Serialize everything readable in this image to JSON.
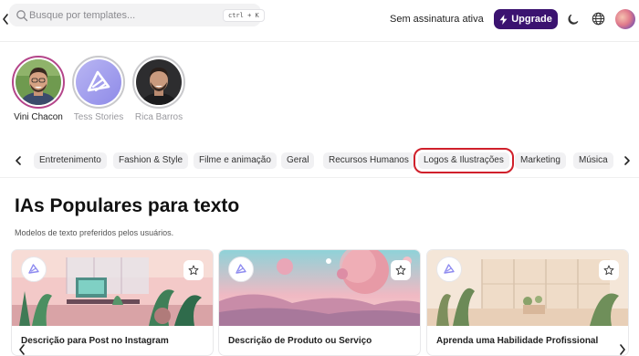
{
  "header": {
    "search": {
      "placeholder": "Busque por templates...",
      "shortcut": "ctrl + K"
    },
    "subscription_status": "Sem assinatura ativa",
    "upgrade_label": "Upgrade"
  },
  "stories": [
    {
      "name": "Vini Chacon",
      "active": true
    },
    {
      "name": "Tess Stories",
      "active": false
    },
    {
      "name": "Rica Barros",
      "active": false
    }
  ],
  "categories": [
    {
      "label": "Entretenimento"
    },
    {
      "label": "Fashion & Style"
    },
    {
      "label": "Filme e animação"
    },
    {
      "label": "Geral"
    },
    {
      "label": "Recursos Humanos"
    },
    {
      "label": "Logos & Ilustrações",
      "highlighted": true
    },
    {
      "label": "Marketing"
    },
    {
      "label": "Música"
    }
  ],
  "section": {
    "title": "IAs Populares para texto",
    "subtitle": "Modelos de texto preferidos pelos usuários."
  },
  "cards": [
    {
      "title": "Descrição para Post no Instagram"
    },
    {
      "title": "Descrição de Produto ou Serviço"
    },
    {
      "title": "Aprenda uma Habilidade Profissional"
    }
  ],
  "colors": {
    "upgrade_bg": "#3b1370",
    "story_active_ring": "#b4458a",
    "highlight_outline": "#d0202b",
    "brand_logo": "#8f8cf0"
  }
}
